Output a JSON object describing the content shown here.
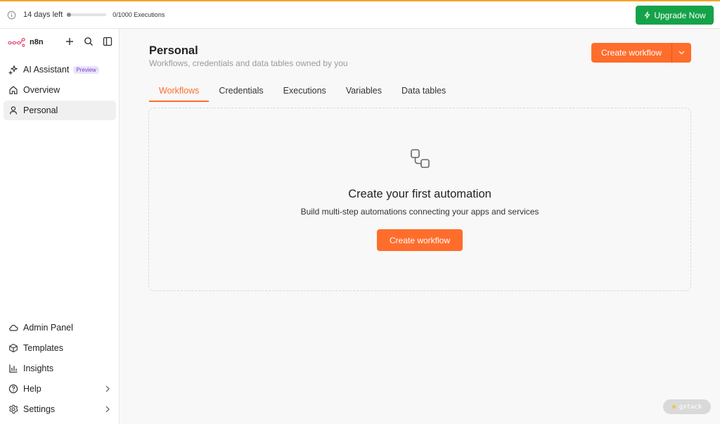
{
  "topbar": {
    "trial_text": "14 days left",
    "trial_progress_fraction": 0.03,
    "executions_text": "0/1000 Executions",
    "upgrade_label": "Upgrade Now"
  },
  "sidebar": {
    "brand": "n8n",
    "items": [
      {
        "label": "AI Assistant",
        "badge": "Preview",
        "icon": "sparkles-icon"
      },
      {
        "label": "Overview",
        "icon": "home-icon"
      },
      {
        "label": "Personal",
        "icon": "user-icon",
        "active": true
      }
    ],
    "bottom_items": [
      {
        "label": "Admin Panel",
        "icon": "cloud-icon"
      },
      {
        "label": "Templates",
        "icon": "box-icon"
      },
      {
        "label": "Insights",
        "icon": "bar-chart-icon"
      },
      {
        "label": "Help",
        "icon": "help-circle-icon",
        "has_chevron": true
      },
      {
        "label": "Settings",
        "icon": "gear-icon",
        "has_chevron": true
      }
    ]
  },
  "main": {
    "title": "Personal",
    "subtitle": "Workflows, credentials and data tables owned by you",
    "create_button": "Create workflow",
    "tabs": [
      {
        "label": "Workflows",
        "active": true
      },
      {
        "label": "Credentials"
      },
      {
        "label": "Executions"
      },
      {
        "label": "Variables"
      },
      {
        "label": "Data tables"
      }
    ],
    "empty_state": {
      "headline": "Create your first automation",
      "description": "Build multi-step automations connecting your apps and services",
      "cta": "Create workflow"
    }
  },
  "overlay": {
    "gstack_label": "gstack"
  },
  "colors": {
    "accent": "#ff6d2c",
    "upgrade": "#15a34a",
    "banner_top": "#f5a524",
    "badge_text": "#7a3cd1"
  }
}
